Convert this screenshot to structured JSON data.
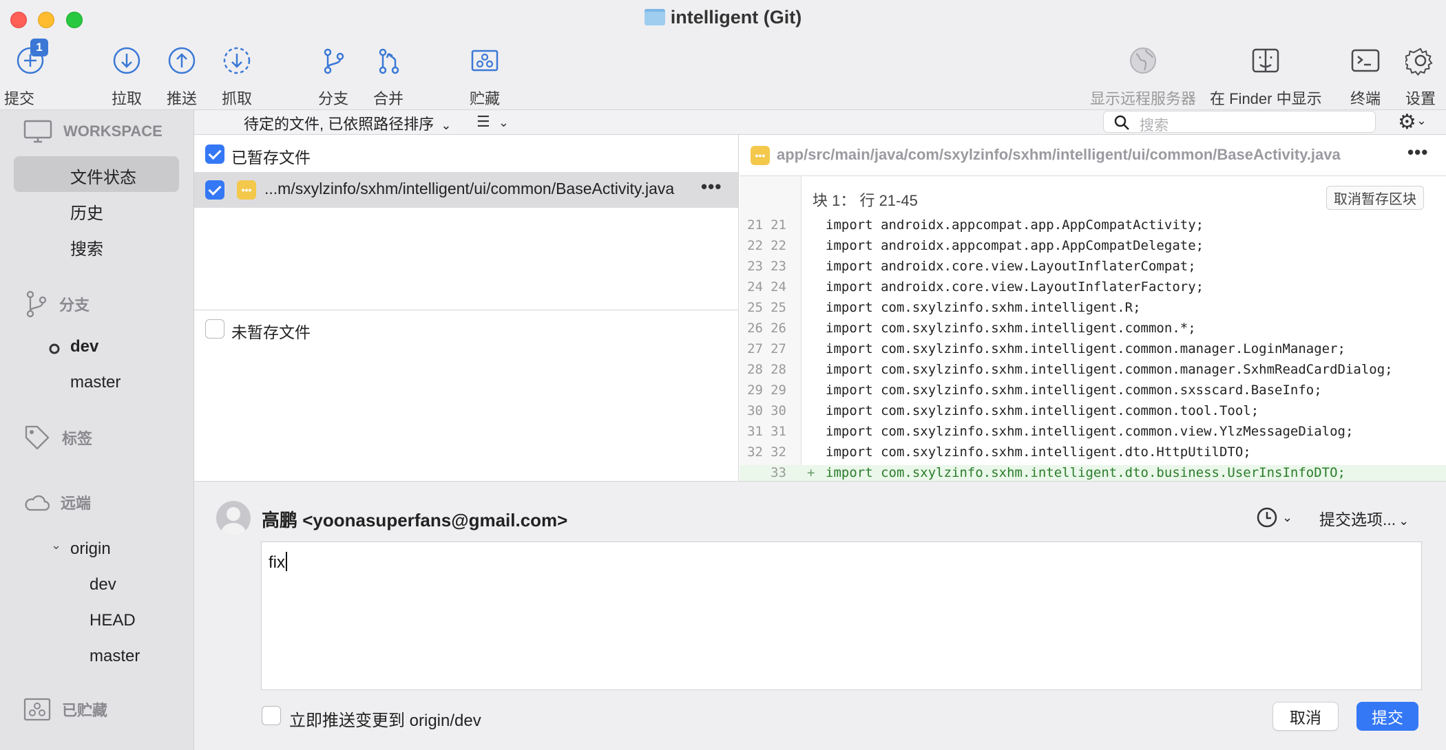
{
  "window": {
    "title": "intelligent (Git)"
  },
  "toolbar": {
    "commit": {
      "label": "提交",
      "badge": "1"
    },
    "pull": {
      "label": "拉取"
    },
    "push": {
      "label": "推送"
    },
    "fetch": {
      "label": "抓取"
    },
    "branch": {
      "label": "分支"
    },
    "merge": {
      "label": "合并"
    },
    "stash": {
      "label": "贮藏"
    },
    "remote_servers": {
      "label": "显示远程服务器"
    },
    "show_in_finder": {
      "label": "在 Finder 中显示"
    },
    "terminal": {
      "label": "终端"
    },
    "settings": {
      "label": "设置"
    }
  },
  "sidebar": {
    "workspace": "WORKSPACE",
    "file_status": "文件状态",
    "history": "历史",
    "search": "搜索",
    "branches": "分支",
    "branch_items": [
      "dev",
      "master"
    ],
    "tags": "标签",
    "remotes": "远端",
    "remote_name": "origin",
    "remote_branches": [
      "dev",
      "HEAD",
      "master"
    ],
    "stashes": "已贮藏"
  },
  "filter": {
    "sort_label": "待定的文件, 已依照路径排序",
    "search_placeholder": "搜索"
  },
  "files": {
    "staged_label": "已暂存文件",
    "staged_file": "...m/sxylzinfo/sxhm/intelligent/ui/common/BaseActivity.java",
    "unstaged_label": "未暂存文件"
  },
  "diff": {
    "path": "app/src/main/java/com/sxylzinfo/sxhm/intelligent/ui/common/BaseActivity.java",
    "hunk_title": "块 1： 行 21-45",
    "unstage_hunk": "取消暂存区块",
    "lines": [
      {
        "old": "21",
        "new": "21",
        "code": "import androidx.appcompat.app.AppCompatActivity;"
      },
      {
        "old": "22",
        "new": "22",
        "code": "import androidx.appcompat.app.AppCompatDelegate;"
      },
      {
        "old": "23",
        "new": "23",
        "code": "import androidx.core.view.LayoutInflaterCompat;"
      },
      {
        "old": "24",
        "new": "24",
        "code": "import androidx.core.view.LayoutInflaterFactory;"
      },
      {
        "old": "25",
        "new": "25",
        "code": "import com.sxylzinfo.sxhm.intelligent.R;"
      },
      {
        "old": "26",
        "new": "26",
        "code": "import com.sxylzinfo.sxhm.intelligent.common.*;"
      },
      {
        "old": "27",
        "new": "27",
        "code": "import com.sxylzinfo.sxhm.intelligent.common.manager.LoginManager;"
      },
      {
        "old": "28",
        "new": "28",
        "code": "import com.sxylzinfo.sxhm.intelligent.common.manager.SxhmReadCardDialog;"
      },
      {
        "old": "29",
        "new": "29",
        "code": "import com.sxylzinfo.sxhm.intelligent.common.sxsscard.BaseInfo;"
      },
      {
        "old": "30",
        "new": "30",
        "code": "import com.sxylzinfo.sxhm.intelligent.common.tool.Tool;"
      },
      {
        "old": "31",
        "new": "31",
        "code": "import com.sxylzinfo.sxhm.intelligent.common.view.YlzMessageDialog;"
      },
      {
        "old": "32",
        "new": "32",
        "code": "import com.sxylzinfo.sxhm.intelligent.dto.HttpUtilDTO;"
      },
      {
        "old": "",
        "new": "33",
        "code": "import com.sxylzinfo.sxhm.intelligent.dto.business.UserInsInfoDTO;",
        "marker": "+"
      }
    ]
  },
  "commit": {
    "author": "高鹏 <yoonasuperfans@gmail.com>",
    "options": "提交选项...",
    "message": "fix",
    "push_label": "立即推送变更到 origin/dev",
    "cancel": "取消",
    "submit": "提交"
  }
}
